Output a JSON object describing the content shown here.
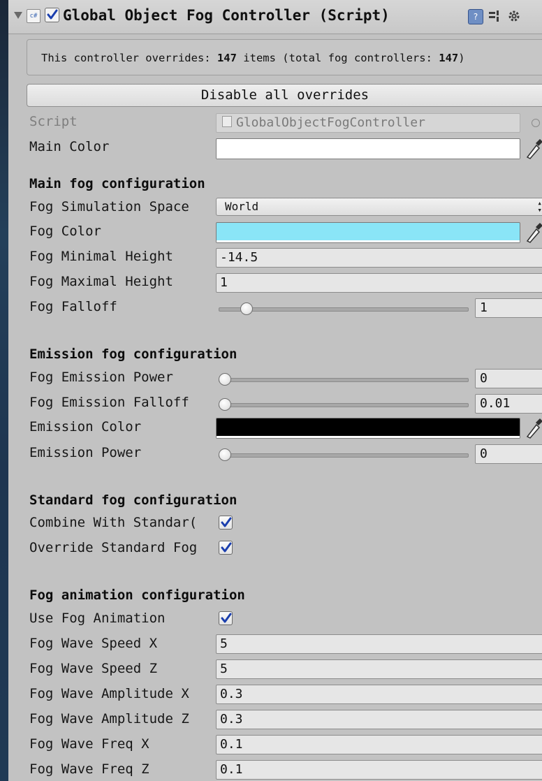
{
  "header": {
    "title": "Global Object Fog Controller (Script)",
    "script_icon_text": "c#",
    "help_icon_text": "?",
    "enabled": true
  },
  "info": {
    "prefix": "This controller overrides: ",
    "count": "147",
    "middle": " items (total fog controllers: ",
    "total": "147",
    "suffix": ")"
  },
  "buttons": {
    "disable_overrides": "Disable all overrides"
  },
  "properties": {
    "script_label": "Script",
    "script_value": "GlobalObjectFogController",
    "main_color_label": "Main Color",
    "main_color": "#ffffff"
  },
  "main_fog": {
    "heading": "Main fog configuration",
    "simulation_space_label": "Fog Simulation Space",
    "simulation_space_value": "World",
    "fog_color_label": "Fog Color",
    "fog_color": "#8ae5f7",
    "min_height_label": "Fog Minimal Height",
    "min_height_value": "-14.5",
    "max_height_label": "Fog Maximal Height",
    "max_height_value": "1",
    "falloff_label": "Fog Falloff",
    "falloff_value": "1",
    "falloff_fraction": 0.09
  },
  "emission": {
    "heading": "Emission fog configuration",
    "power_label": "Fog Emission Power",
    "power_value": "0",
    "power_fraction": 0.0,
    "falloff_label": "Fog Emission Falloff",
    "falloff_value": "0.01",
    "falloff_fraction": 0.0,
    "color_label": "Emission Color",
    "color": "#000000",
    "emission_power_label": "Emission Power",
    "emission_power_value": "0",
    "emission_power_fraction": 0.0
  },
  "standard": {
    "heading": "Standard fog configuration",
    "combine_label": "Combine With Standar(",
    "combine_checked": true,
    "override_label": "Override Standard Fog",
    "override_checked": true
  },
  "animation": {
    "heading": "Fog animation configuration",
    "use_label": "Use Fog Animation",
    "use_checked": true,
    "wave_speed_x_label": "Fog Wave Speed X",
    "wave_speed_x": "5",
    "wave_speed_z_label": "Fog Wave Speed Z",
    "wave_speed_z": "5",
    "wave_amp_x_label": "Fog Wave Amplitude X",
    "wave_amp_x": "0.3",
    "wave_amp_z_label": "Fog Wave Amplitude Z",
    "wave_amp_z": "0.3",
    "wave_freq_x_label": "Fog Wave Freq X",
    "wave_freq_x": "0.1",
    "wave_freq_z_label": "Fog Wave Freq Z",
    "wave_freq_z": "0.1"
  }
}
